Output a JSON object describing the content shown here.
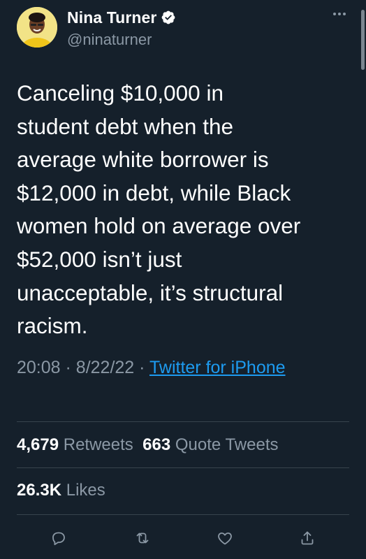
{
  "author": {
    "display_name": "Nina Turner",
    "handle": "@ninaturner",
    "verified": true
  },
  "tweet": {
    "text": "Canceling $10,000 in\nstudent debt when the\naverage white borrower is\n$12,000 in debt, while Black\nwomen hold on average over\n$52,000 isn’t just\nunacceptable, it’s structural\nracism.",
    "time": "20:08",
    "date": "8/22/22",
    "separator": "·",
    "source": "Twitter for iPhone"
  },
  "stats": {
    "retweets_count": "4,679",
    "retweets_label": "Retweets",
    "quote_count": "663",
    "quote_label": "Quote Tweets",
    "likes_count": "26.3K",
    "likes_label": "Likes"
  },
  "colors": {
    "background": "#15202b",
    "text_primary": "#ffffff",
    "text_secondary": "#8b98a5",
    "link": "#1d9bf0",
    "divider": "#38444d"
  },
  "icons": {
    "more": "more-options-icon",
    "verified": "verified-badge-icon",
    "reply": "reply-icon",
    "retweet": "retweet-icon",
    "like": "like-icon",
    "share": "share-icon"
  }
}
